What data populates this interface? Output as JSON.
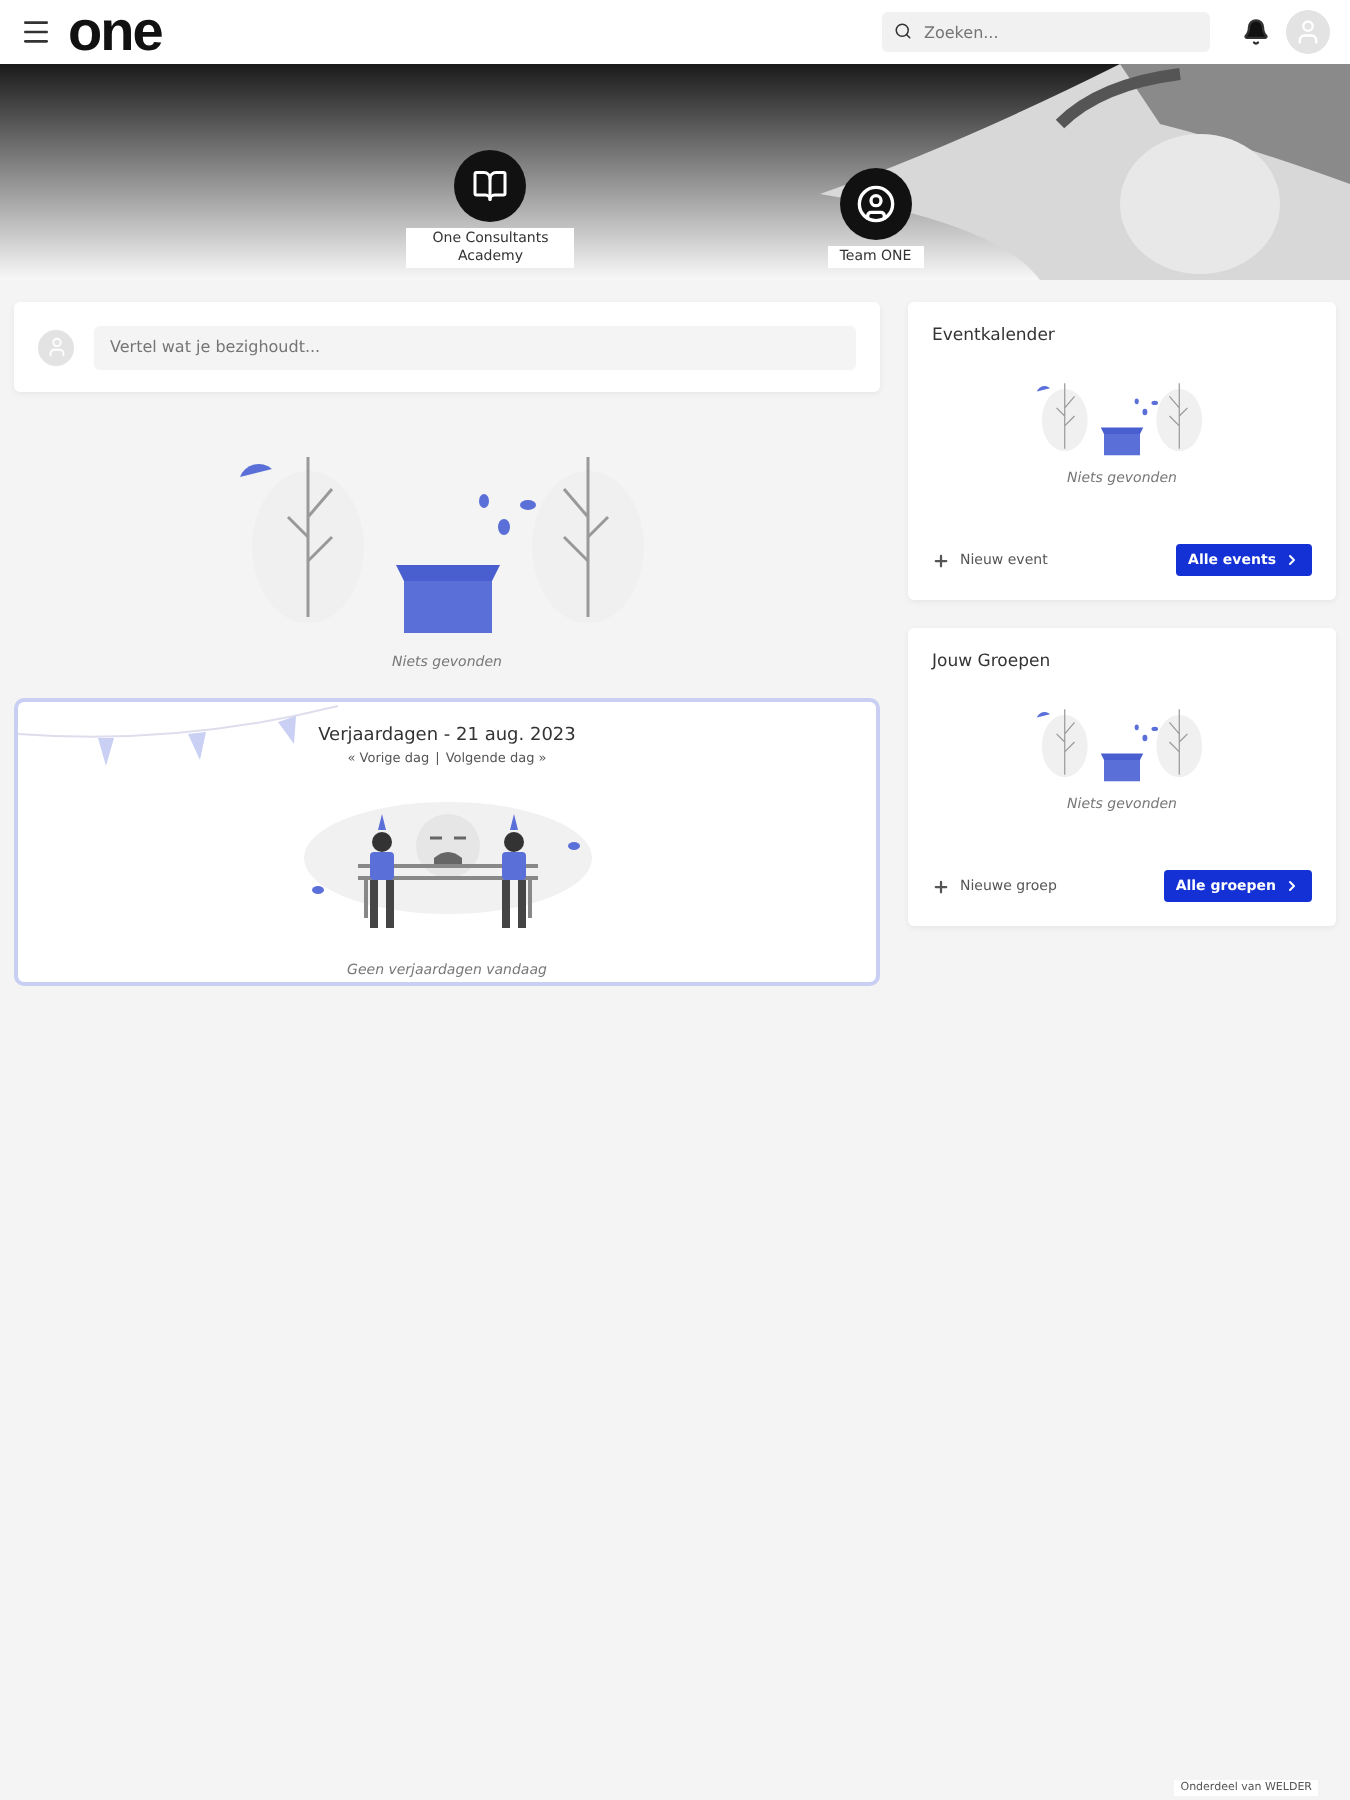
{
  "header": {
    "logo": "one",
    "search": {
      "placeholder": "Zoeken..."
    }
  },
  "banner": {
    "kind": "picture",
    "groups": [
      {
        "label": "One Consultants Academy"
      },
      {
        "label": "Team ONE"
      }
    ]
  },
  "composer": {
    "placeholder": "Vertel wat je bezighoudt..."
  },
  "feed": {
    "empty_text": "Niets gevonden"
  },
  "birthdays": {
    "title": "Verjaardagen - 21 aug. 2023",
    "prev": "« Vorige dag",
    "separator": "|",
    "next": "Volgende dag »",
    "empty_text": "Geen verjaardagen vandaag"
  },
  "widgets": [
    {
      "title": "Eventkalender",
      "empty_text": "Niets gevonden",
      "add_label": "Nieuw event",
      "button": "Alle events"
    },
    {
      "title": "Jouw Groepen",
      "empty_text": "Niets gevonden",
      "add_label": "Nieuwe groep",
      "button": "Alle groepen"
    }
  ],
  "footer": "Onderdeel van WELDER"
}
